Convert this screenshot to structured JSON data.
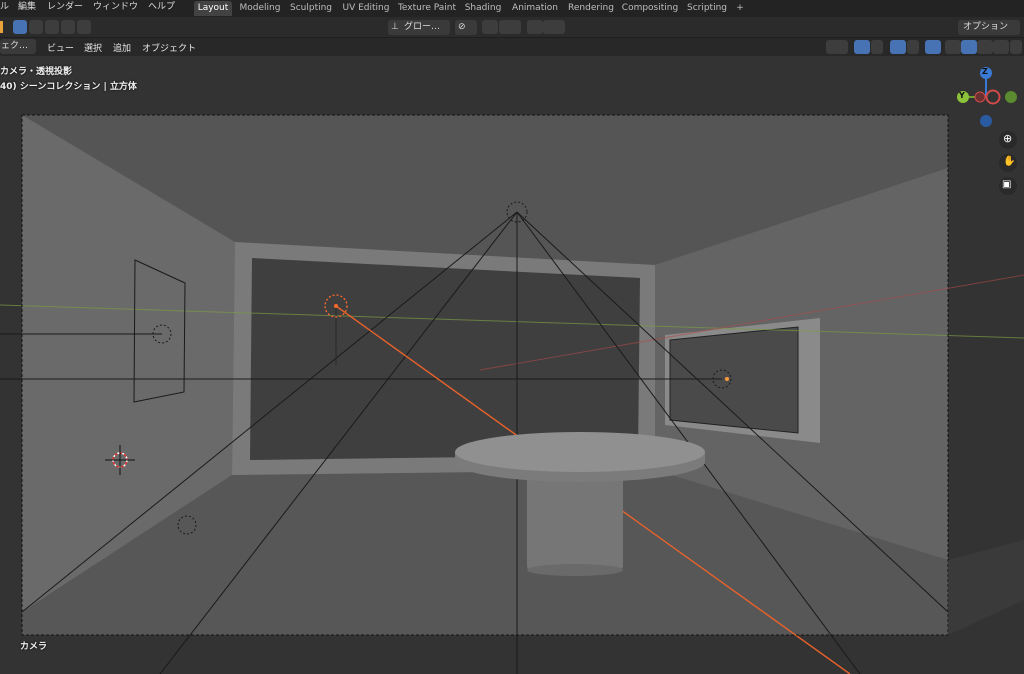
{
  "menu": [
    "ル",
    "編集",
    "レンダー",
    "ウィンドウ",
    "ヘルプ"
  ],
  "workspace_tabs": [
    "Layout",
    "Modeling",
    "Sculpting",
    "UV Editing",
    "Texture Paint",
    "Shading",
    "Animation",
    "Rendering",
    "Compositing",
    "Scripting"
  ],
  "add_tab_label": "+",
  "toolbar": {
    "transform_orientation": "グロー…",
    "options_label": "オプション"
  },
  "header": {
    "mode": "ェク…",
    "menus": [
      "ビュー",
      "選択",
      "追加",
      "オブジェクト"
    ]
  },
  "viewport": {
    "view_name": "カメラ・透視投影",
    "collection_info": "40) シーンコレクション | 立方体",
    "camera_label": "カメラ"
  },
  "gizmo": {
    "z": "Z",
    "y": "Y"
  },
  "colors": {
    "accent": "#4772b3",
    "active_tab": "#424242",
    "light": "#ff6a2a"
  }
}
